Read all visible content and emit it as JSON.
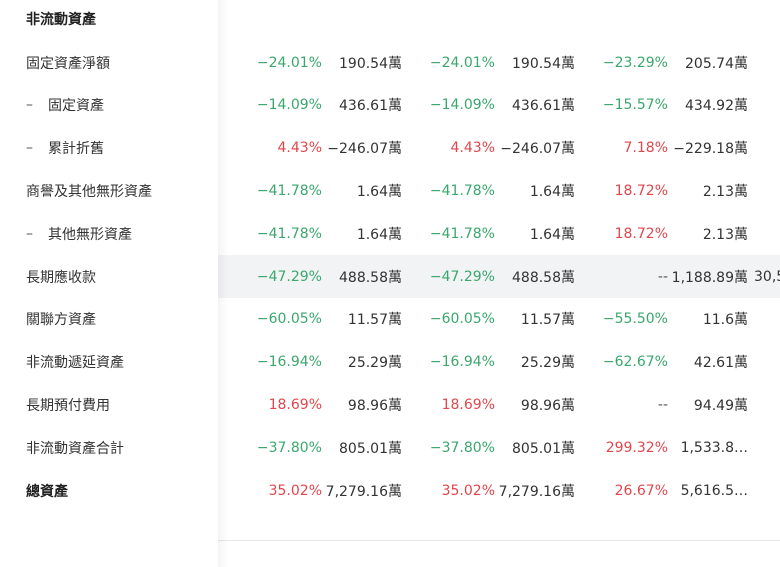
{
  "section_title": "非流動資產",
  "rows": [
    {
      "label": "固定資產淨額",
      "dash": "",
      "cols": [
        {
          "pct": "−24.01%",
          "dir": "neg",
          "val": "190.54萬"
        },
        {
          "pct": "−24.01%",
          "dir": "neg",
          "val": "190.54萬"
        },
        {
          "pct": "−23.29%",
          "dir": "neg",
          "val": "205.74萬"
        }
      ]
    },
    {
      "label": "固定資產",
      "dash": "–",
      "cols": [
        {
          "pct": "−14.09%",
          "dir": "neg",
          "val": "436.61萬"
        },
        {
          "pct": "−14.09%",
          "dir": "neg",
          "val": "436.61萬"
        },
        {
          "pct": "−15.57%",
          "dir": "neg",
          "val": "434.92萬"
        }
      ]
    },
    {
      "label": "累計折舊",
      "dash": "–",
      "cols": [
        {
          "pct": "4.43%",
          "dir": "pos",
          "val": "−246.07萬"
        },
        {
          "pct": "4.43%",
          "dir": "pos",
          "val": "−246.07萬"
        },
        {
          "pct": "7.18%",
          "dir": "pos",
          "val": "−229.18萬"
        }
      ]
    },
    {
      "label": "商譽及其他無形資產",
      "dash": "",
      "cols": [
        {
          "pct": "−41.78%",
          "dir": "neg",
          "val": "1.64萬"
        },
        {
          "pct": "−41.78%",
          "dir": "neg",
          "val": "1.64萬"
        },
        {
          "pct": "18.72%",
          "dir": "pos",
          "val": "2.13萬"
        }
      ]
    },
    {
      "label": "其他無形資產",
      "dash": "–",
      "cols": [
        {
          "pct": "−41.78%",
          "dir": "neg",
          "val": "1.64萬"
        },
        {
          "pct": "−41.78%",
          "dir": "neg",
          "val": "1.64萬"
        },
        {
          "pct": "18.72%",
          "dir": "pos",
          "val": "2.13萬"
        }
      ]
    },
    {
      "label": "長期應收款",
      "dash": "",
      "highlight": true,
      "cols": [
        {
          "pct": "−47.29%",
          "dir": "neg",
          "val": "488.58萬"
        },
        {
          "pct": "−47.29%",
          "dir": "neg",
          "val": "488.58萬"
        },
        {
          "pct": "--",
          "dir": "na",
          "val": "1,188.89萬"
        }
      ],
      "overflow": "30,5"
    },
    {
      "label": "關聯方資產",
      "dash": "",
      "cols": [
        {
          "pct": "−60.05%",
          "dir": "neg",
          "val": "11.57萬"
        },
        {
          "pct": "−60.05%",
          "dir": "neg",
          "val": "11.57萬"
        },
        {
          "pct": "−55.50%",
          "dir": "neg",
          "val": "11.6萬"
        }
      ]
    },
    {
      "label": "非流動遞延資產",
      "dash": "",
      "cols": [
        {
          "pct": "−16.94%",
          "dir": "neg",
          "val": "25.29萬"
        },
        {
          "pct": "−16.94%",
          "dir": "neg",
          "val": "25.29萬"
        },
        {
          "pct": "−62.67%",
          "dir": "neg",
          "val": "42.61萬"
        }
      ]
    },
    {
      "label": "長期預付費用",
      "dash": "",
      "cols": [
        {
          "pct": "18.69%",
          "dir": "pos",
          "val": "98.96萬"
        },
        {
          "pct": "18.69%",
          "dir": "pos",
          "val": "98.96萬"
        },
        {
          "pct": "--",
          "dir": "na",
          "val": "94.49萬"
        }
      ]
    },
    {
      "label": "非流動資產合計",
      "dash": "",
      "cols": [
        {
          "pct": "−37.80%",
          "dir": "neg",
          "val": "805.01萬"
        },
        {
          "pct": "−37.80%",
          "dir": "neg",
          "val": "805.01萬"
        },
        {
          "pct": "299.32%",
          "dir": "pos",
          "val": "1,533.8…"
        }
      ]
    },
    {
      "label": "總資產",
      "dash": "",
      "bold": true,
      "cols": [
        {
          "pct": "35.02%",
          "dir": "pos",
          "val": "7,279.16萬"
        },
        {
          "pct": "35.02%",
          "dir": "pos",
          "val": "7,279.16萬"
        },
        {
          "pct": "26.67%",
          "dir": "pos",
          "val": "5,616.5…"
        }
      ]
    }
  ],
  "colors": {
    "negative": "#3aa76d",
    "positive": "#e0474c",
    "highlight_row": "#f2f3f5"
  }
}
